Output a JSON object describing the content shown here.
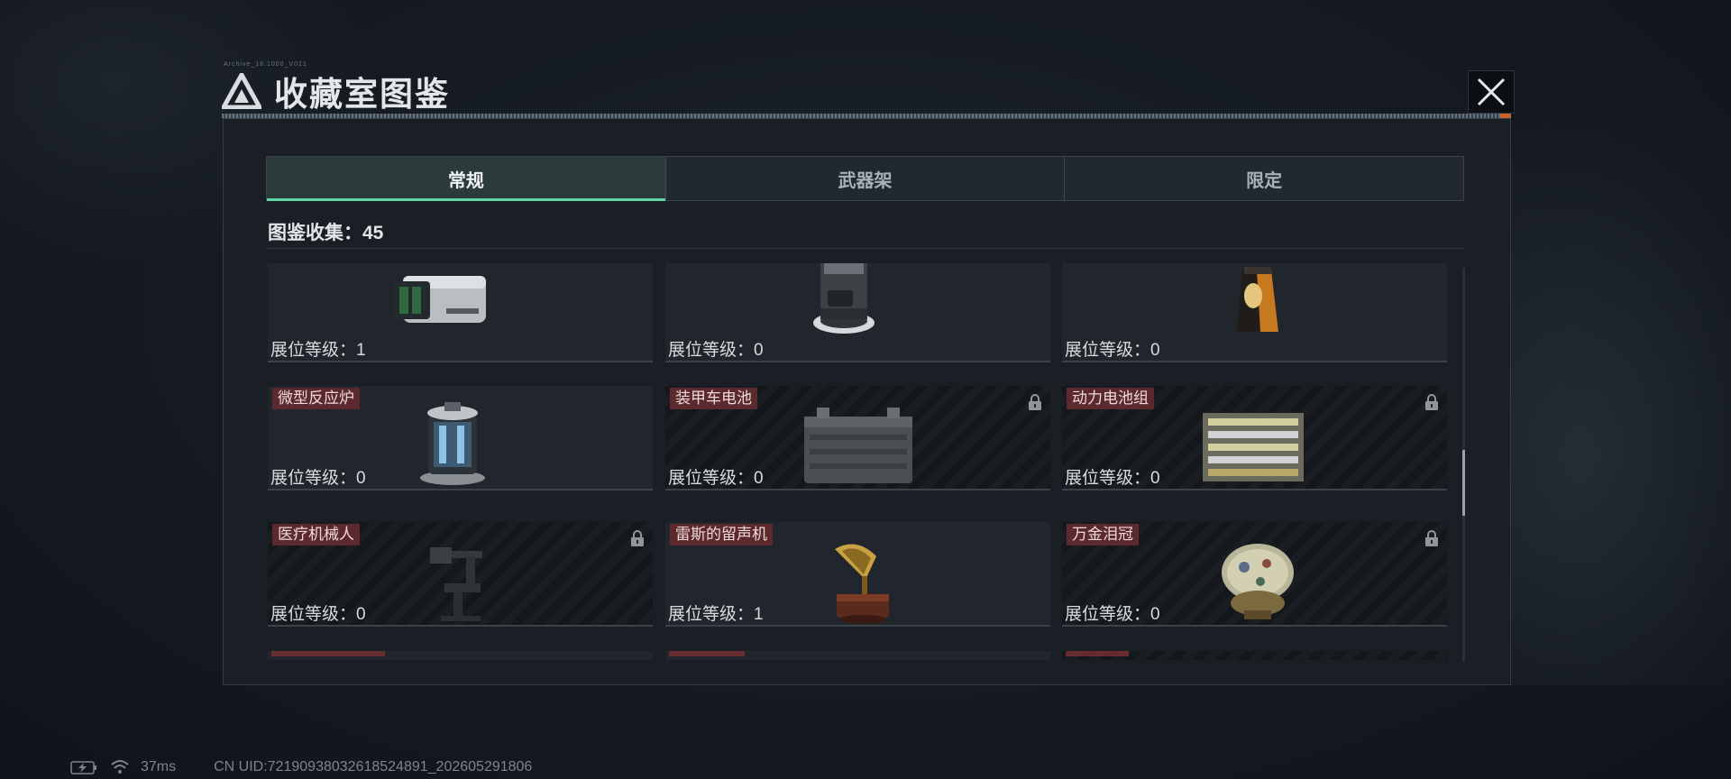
{
  "header": {
    "title": "收藏室图鉴",
    "tiny_text": "Archive_18.1000_V021"
  },
  "tabs": [
    {
      "label": "常规",
      "active": true
    },
    {
      "label": "武器架",
      "active": false
    },
    {
      "label": "限定",
      "active": false
    }
  ],
  "collection": {
    "label": "图鉴收集：",
    "count": "45"
  },
  "items": [
    {
      "name": "",
      "level": "展位等级：1",
      "locked": false,
      "icon": "projector-device-icon"
    },
    {
      "name": "",
      "level": "展位等级：0",
      "locked": false,
      "icon": "robot-vacuum-dock-icon"
    },
    {
      "name": "",
      "level": "展位等级：0",
      "locked": false,
      "icon": "coffee-bag-icon"
    },
    {
      "name": "微型反应炉",
      "level": "展位等级：0",
      "locked": false,
      "icon": "micro-reactor-icon"
    },
    {
      "name": "装甲车电池",
      "level": "展位等级：0",
      "locked": true,
      "icon": "vehicle-battery-icon"
    },
    {
      "name": "动力电池组",
      "level": "展位等级：0",
      "locked": true,
      "icon": "battery-pack-icon"
    },
    {
      "name": "医疗机械人",
      "level": "展位等级：0",
      "locked": true,
      "icon": "medical-robot-icon"
    },
    {
      "name": "雷斯的留声机",
      "level": "展位等级：1",
      "locked": false,
      "icon": "gramophone-icon"
    },
    {
      "name": "万金泪冠",
      "level": "展位等级：0",
      "locked": true,
      "icon": "jeweled-egg-icon"
    }
  ],
  "status_bar": {
    "ping": "37ms",
    "uid": "CN UID:72190938032618524891_202605291806"
  },
  "colors": {
    "accent_tab": "#5fd6a6",
    "name_badge": "#5c2a2e",
    "title_accent": "#c8612b"
  }
}
